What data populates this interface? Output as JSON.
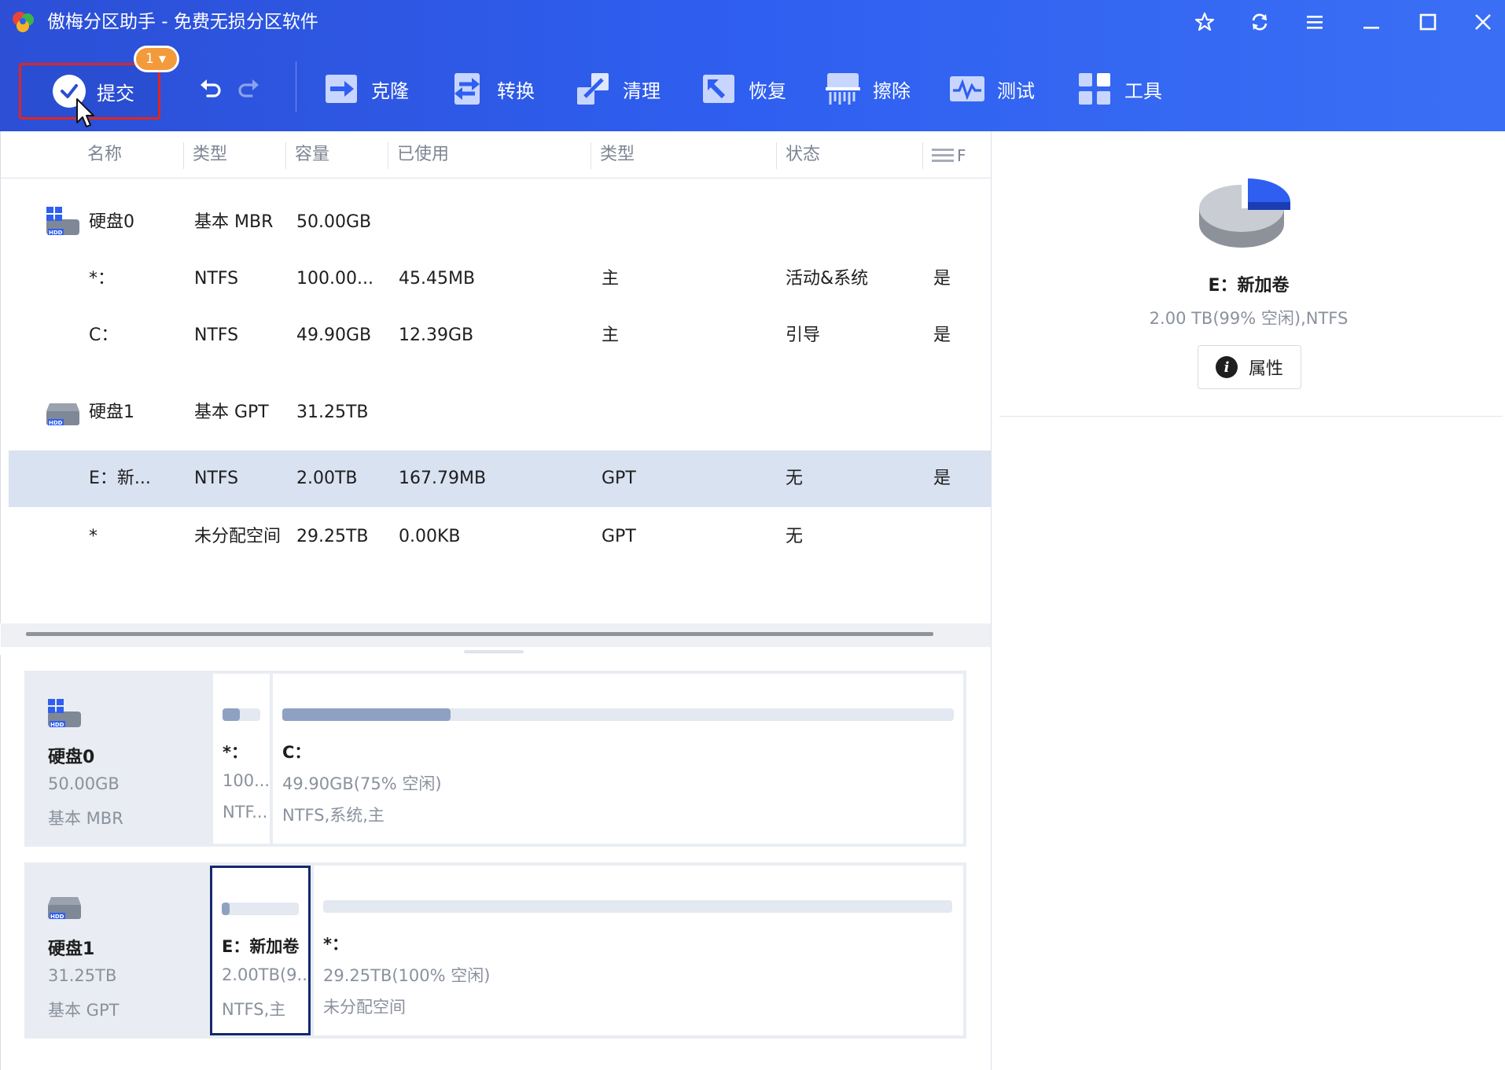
{
  "app": {
    "title": "傲梅分区助手 - 免费无损分区软件"
  },
  "toolbar": {
    "commit_label": "提交",
    "pending_count": "1",
    "tools": [
      {
        "label": "克隆",
        "icon": "clone-icon"
      },
      {
        "label": "转换",
        "icon": "convert-icon"
      },
      {
        "label": "清理",
        "icon": "clean-icon"
      },
      {
        "label": "恢复",
        "icon": "recover-icon"
      },
      {
        "label": "擦除",
        "icon": "wipe-icon"
      },
      {
        "label": "测试",
        "icon": "test-icon"
      },
      {
        "label": "工具",
        "icon": "tools-icon"
      }
    ]
  },
  "table": {
    "columns": [
      "名称",
      "类型",
      "容量",
      "已使用",
      "类型",
      "状态",
      "F"
    ],
    "rows": [
      {
        "kind": "disk",
        "name": "硬盘0",
        "type": "基本 MBR",
        "capacity": "50.00GB",
        "used": "",
        "ptype": "",
        "status": "",
        "flag": ""
      },
      {
        "kind": "part",
        "name": "*：",
        "type": "NTFS",
        "capacity": "100.00...",
        "used": "45.45MB",
        "ptype": "主",
        "status": "活动&系统",
        "flag": "是"
      },
      {
        "kind": "part",
        "name": "C：",
        "type": "NTFS",
        "capacity": "49.90GB",
        "used": "12.39GB",
        "ptype": "主",
        "status": "引导",
        "flag": "是"
      },
      {
        "kind": "disk",
        "name": "硬盘1",
        "type": "基本 GPT",
        "capacity": "31.25TB",
        "used": "",
        "ptype": "",
        "status": "",
        "flag": ""
      },
      {
        "kind": "part",
        "name": "E：新...",
        "type": "NTFS",
        "capacity": "2.00TB",
        "used": "167.79MB",
        "ptype": "GPT",
        "status": "无",
        "flag": "是",
        "selected": true
      },
      {
        "kind": "part",
        "name": "*",
        "type": "未分配空间",
        "capacity": "29.25TB",
        "used": "0.00KB",
        "ptype": "GPT",
        "status": "无",
        "flag": ""
      }
    ]
  },
  "disk_map": {
    "disks": [
      {
        "name": "硬盘0",
        "capacity": "50.00GB",
        "type": "基本 MBR",
        "partitions": [
          {
            "name": "*：",
            "info": "100...",
            "fs": "NTF...",
            "used_fraction": 0.45
          },
          {
            "name": "C：",
            "info": "49.90GB(75% 空闲)",
            "fs": "NTFS,系统,主",
            "used_fraction": 0.25
          }
        ]
      },
      {
        "name": "硬盘1",
        "capacity": "31.25TB",
        "type": "基本 GPT",
        "partitions": [
          {
            "name": "E：新加卷",
            "info": "2.00TB(9...",
            "fs": "NTFS,主",
            "used_fraction": 0.01,
            "selected": true
          },
          {
            "name": "*：",
            "info": "29.25TB(100% 空闲)",
            "fs": "未分配空间",
            "used_fraction": 0.0
          }
        ]
      }
    ]
  },
  "details": {
    "name": "E：新加卷",
    "info": "2.00 TB(99% 空闲),NTFS",
    "properties_label": "属性",
    "used_fraction": 0.01
  },
  "colors": {
    "header": "#2f5ff0",
    "selected_row": "#d9e2f1",
    "badge": "#f39a3b",
    "commit_border": "#e0261f"
  }
}
